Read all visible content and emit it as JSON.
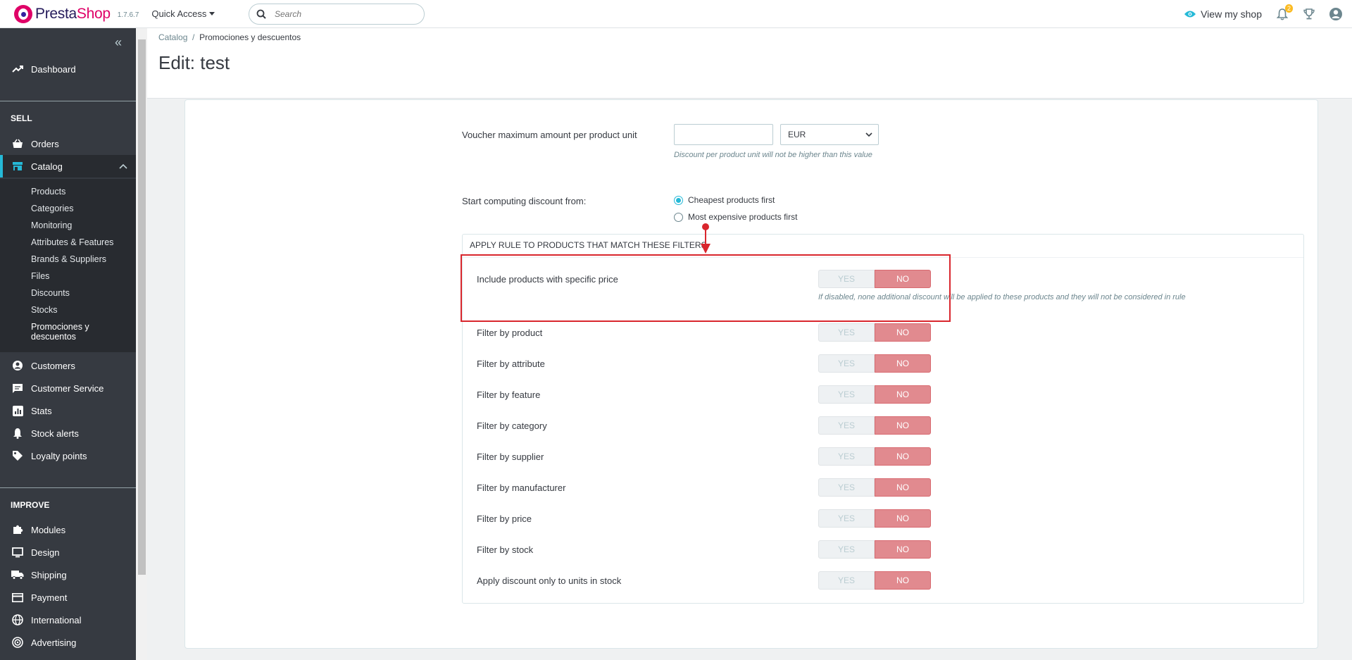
{
  "header": {
    "brand_part1": "Presta",
    "brand_part2": "Shop",
    "version": "1.7.6.7",
    "quick_access": "Quick Access",
    "search_placeholder": "Search",
    "view_shop": "View my shop",
    "notifications_count": "2"
  },
  "sidebar": {
    "dashboard": "Dashboard",
    "sell_title": "SELL",
    "orders": "Orders",
    "catalog": "Catalog",
    "catalog_sub": [
      "Products",
      "Categories",
      "Monitoring",
      "Attributes & Features",
      "Brands & Suppliers",
      "Files",
      "Discounts",
      "Stocks",
      "Promociones y",
      "descuentos"
    ],
    "customers": "Customers",
    "customer_service": "Customer Service",
    "stats": "Stats",
    "stock_alerts": "Stock alerts",
    "loyalty_points": "Loyalty points",
    "improve_title": "IMPROVE",
    "modules": "Modules",
    "design": "Design",
    "shipping": "Shipping",
    "payment": "Payment",
    "international": "International",
    "advertising": "Advertising"
  },
  "breadcrumb": {
    "parent": "Catalog",
    "separator": "/",
    "current": "Promociones y descuentos"
  },
  "page_title": "Edit: test",
  "form": {
    "voucher_label": "Voucher maximum amount per product unit",
    "voucher_value": "",
    "currency": "EUR",
    "voucher_help": "Discount per product unit will not be higher than this value",
    "start_label": "Start computing discount from:",
    "radio_cheapest": "Cheapest products first",
    "radio_expensive": "Most expensive products first",
    "filters_title": "APPLY RULE TO PRODUCTS THAT MATCH THESE FILTERS",
    "specific_price_label": "Include products with specific price",
    "specific_price_help": "If disabled, none additional discount will be applied to these products and they will not be considered in rule",
    "yes": "YES",
    "no": "NO",
    "filters": [
      "Filter by product",
      "Filter by attribute",
      "Filter by feature",
      "Filter by category",
      "Filter by supplier",
      "Filter by manufacturer",
      "Filter by price",
      "Filter by stock",
      "Apply discount only to units in stock"
    ]
  }
}
